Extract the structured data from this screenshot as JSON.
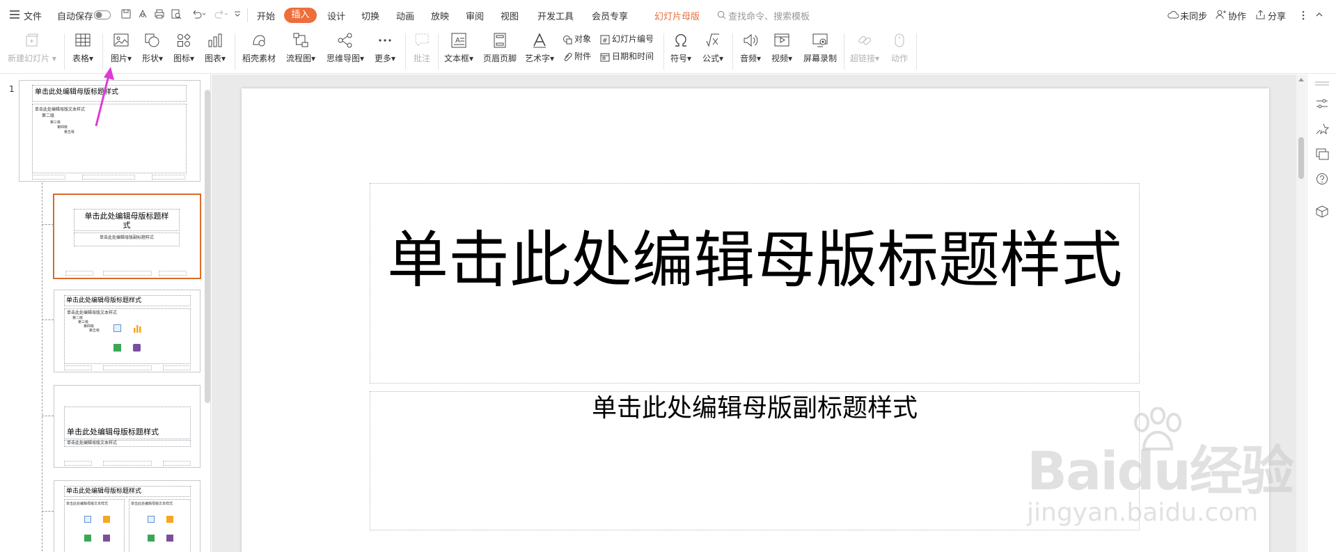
{
  "menubar": {
    "file_label": "文件",
    "autosave_label": "自动保存",
    "tabs": [
      "开始",
      "插入",
      "设计",
      "切换",
      "动画",
      "放映",
      "审阅",
      "视图",
      "开发工具",
      "会员专享"
    ],
    "active_tab": "插入",
    "context_tab": "幻灯片母版",
    "search_placeholder": "查找命令、搜索模板",
    "sync_label": "未同步",
    "collab_label": "协作",
    "share_label": "分享"
  },
  "ribbon": {
    "new_slide": "新建幻灯片",
    "table": "表格",
    "picture": "图片",
    "shape": "形状",
    "icon": "图标",
    "chart": "图表",
    "daoke": "稻壳素材",
    "flowchart": "流程图",
    "mindmap": "思维导图",
    "more": "更多",
    "comment": "批注",
    "textbox": "文本框",
    "header_footer": "页眉页脚",
    "wordart": "艺术字",
    "object": "对象",
    "attachment": "附件",
    "slide_number": "幻灯片编号",
    "datetime": "日期和时间",
    "symbol": "符号",
    "formula": "公式",
    "audio": "音频",
    "video": "视频",
    "screen_record": "屏幕录制",
    "hyperlink": "超链接",
    "action": "动作"
  },
  "thumbnails": {
    "slide_number": "1",
    "master_title": "单击此处编辑母版标题样式",
    "master_text": "单击此处编辑母版文本样式",
    "level2": "第二级",
    "level3": "第三级",
    "level4": "第四级",
    "level5": "第五级",
    "layout_title_wrapped": "单击此处编辑母版标题样\n式",
    "layout_subtitle": "单击此处编辑母版副标题样式",
    "layout_text": "单击此处编辑母版文本样式"
  },
  "slide": {
    "title": "单击此处编辑母版标题样式",
    "subtitle": "单击此处编辑母版副标题样式"
  },
  "watermark": {
    "brand": "Baidu经验",
    "url": "jingyan.baidu.com"
  },
  "colors": {
    "accent": "#ef6d3b",
    "annotation_arrow": "#e03ad6",
    "selection_border": "#d96a2a"
  }
}
